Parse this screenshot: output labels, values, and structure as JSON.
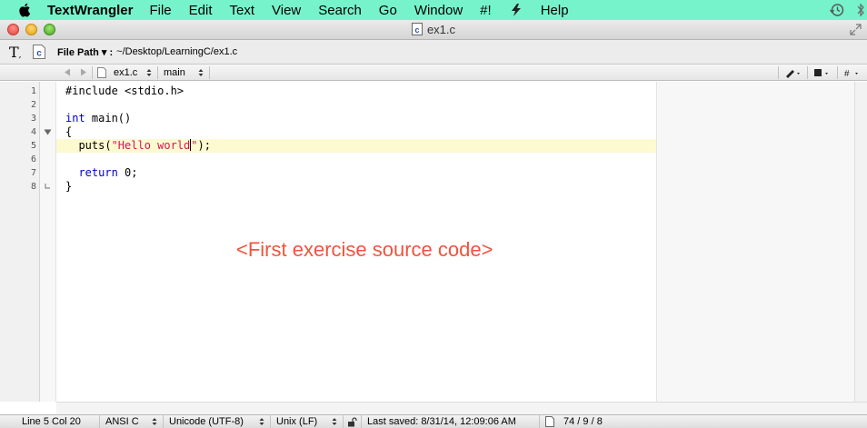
{
  "menubar": {
    "app_name": "TextWrangler",
    "items": [
      "File",
      "Edit",
      "Text",
      "View",
      "Search",
      "Go",
      "Window",
      "#!"
    ],
    "help": "Help"
  },
  "window": {
    "title": "ex1.c"
  },
  "toolbar": {
    "filepath_label": "File Path ▾ :",
    "filepath_value": "~/Desktop/LearningC/ex1.c"
  },
  "navbar": {
    "file_name": "ex1.c",
    "function_name": "main"
  },
  "editor": {
    "line_numbers": [
      "1",
      "2",
      "3",
      "4",
      "5",
      "6",
      "7",
      "8"
    ],
    "lines": {
      "l1": "#include <stdio.h>",
      "l3_kw": "int",
      "l3_rest": " main()",
      "l4": "{",
      "l5_pre": "  puts(",
      "l5_str_a": "\"Hello world",
      "l5_str_b": "\"",
      "l5_post": ");",
      "l7_pre": "  ",
      "l7_kw": "return",
      "l7_rest": " 0;",
      "l8": "}"
    },
    "annotation": "<First exercise source code>"
  },
  "statusbar": {
    "position": "Line 5 Col 20",
    "language": "ANSI C",
    "encoding": "Unicode (UTF-8)",
    "line_endings": "Unix (LF)",
    "last_saved": "Last saved: 8/31/14, 12:09:06 AM",
    "counts": "74 / 9 / 8"
  },
  "colors": {
    "menubar_bg": "#77f3cb",
    "keyword": "#0000c8",
    "string": "#d4145a",
    "cursor_line": "#fdfad0",
    "annotation": "#f0543c"
  }
}
